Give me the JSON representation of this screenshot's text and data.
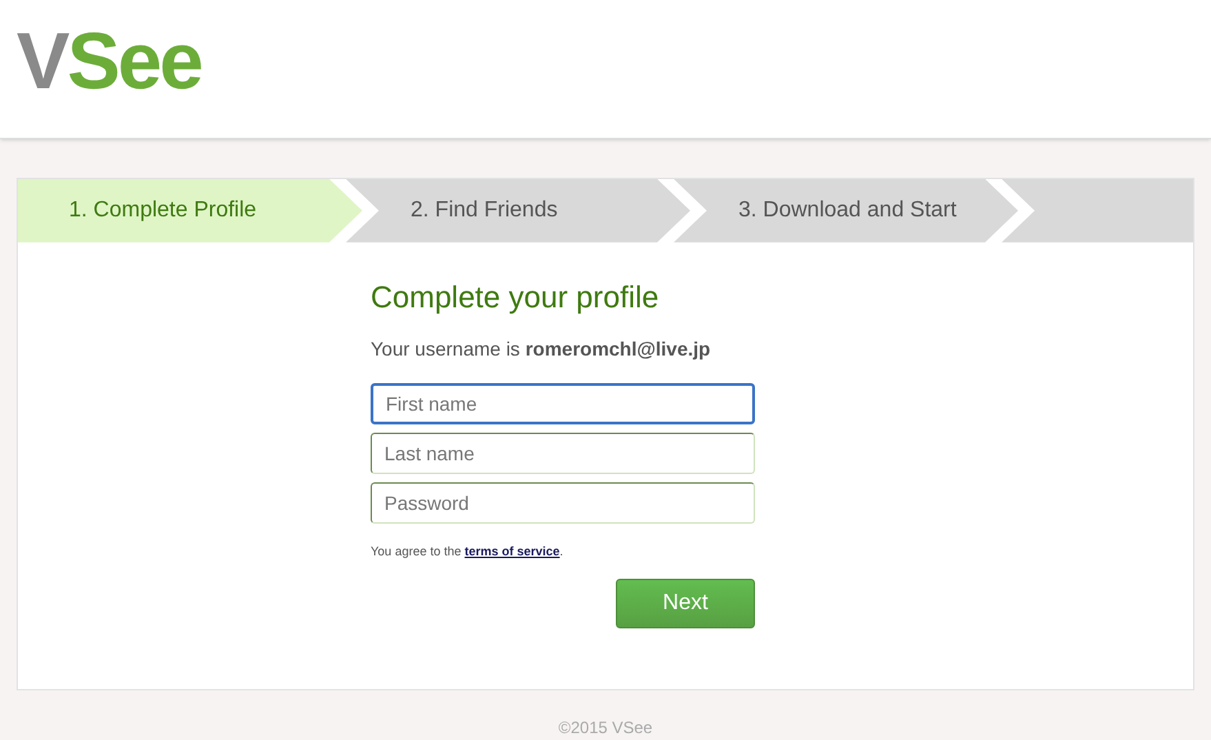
{
  "logo": {
    "first": "V",
    "rest": "See"
  },
  "steps": [
    {
      "label": "1. Complete Profile",
      "selected": true
    },
    {
      "label": "2. Find Friends",
      "selected": false
    },
    {
      "label": "3. Download and Start",
      "selected": false
    }
  ],
  "form": {
    "title": "Complete your profile",
    "username_prefix": "Your username is",
    "username": "romeromchl@live.jp",
    "fields": [
      {
        "placeholder": "First name",
        "focused": true
      },
      {
        "placeholder": "Last name",
        "focused": false
      },
      {
        "placeholder": "Password",
        "focused": false
      }
    ],
    "agreement": "You agree to the",
    "terms_link": "terms of service",
    "agreement_end": ".",
    "submit": "Next"
  },
  "footer": "©2015 VSee"
}
